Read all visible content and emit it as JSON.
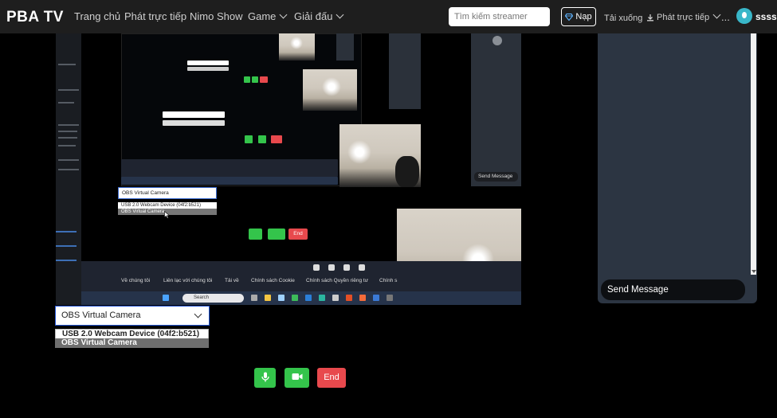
{
  "nav": {
    "brand": "PBA TV",
    "links": [
      "Trang chủ",
      "Phát trực tiếp",
      "Nimo Show",
      "Game",
      "Giải đấu"
    ],
    "search_placeholder": "Tìm kiếm streamer",
    "topup_label": "Nạp",
    "download_label": "Tải xuống",
    "live_label": "Phát trực tiếp",
    "more_label": "...",
    "username": "sssss"
  },
  "screen_share": {
    "camera_select": "OBS Virtual Camera",
    "options": [
      "USB 2.0 Webcam Device (04f2:b521)",
      "OBS Virtual Camera"
    ],
    "end_label": "End",
    "footer_links": [
      "Về chúng tôi",
      "Liên lạc với chúng tôi",
      "Tải về",
      "Chính sách Cookie",
      "Chính sách Quyền riêng tư",
      "Chính s"
    ],
    "taskbar_search": "Search",
    "send_message": "Send Message"
  },
  "chat": {
    "send_placeholder": "Send Message"
  },
  "controls": {
    "camera_select": "OBS Virtual Camera",
    "options": [
      "USB 2.0 Webcam Device (04f2:b521)",
      "OBS Virtual Camera"
    ],
    "mic_icon": "microphone-icon",
    "video_icon": "video-camera-icon",
    "end_label": "End"
  },
  "colors": {
    "accent_green": "#34c44b",
    "accent_red": "#e8494d",
    "dropdown_border": "#2356d6",
    "chat_panel": "#2c3542"
  }
}
